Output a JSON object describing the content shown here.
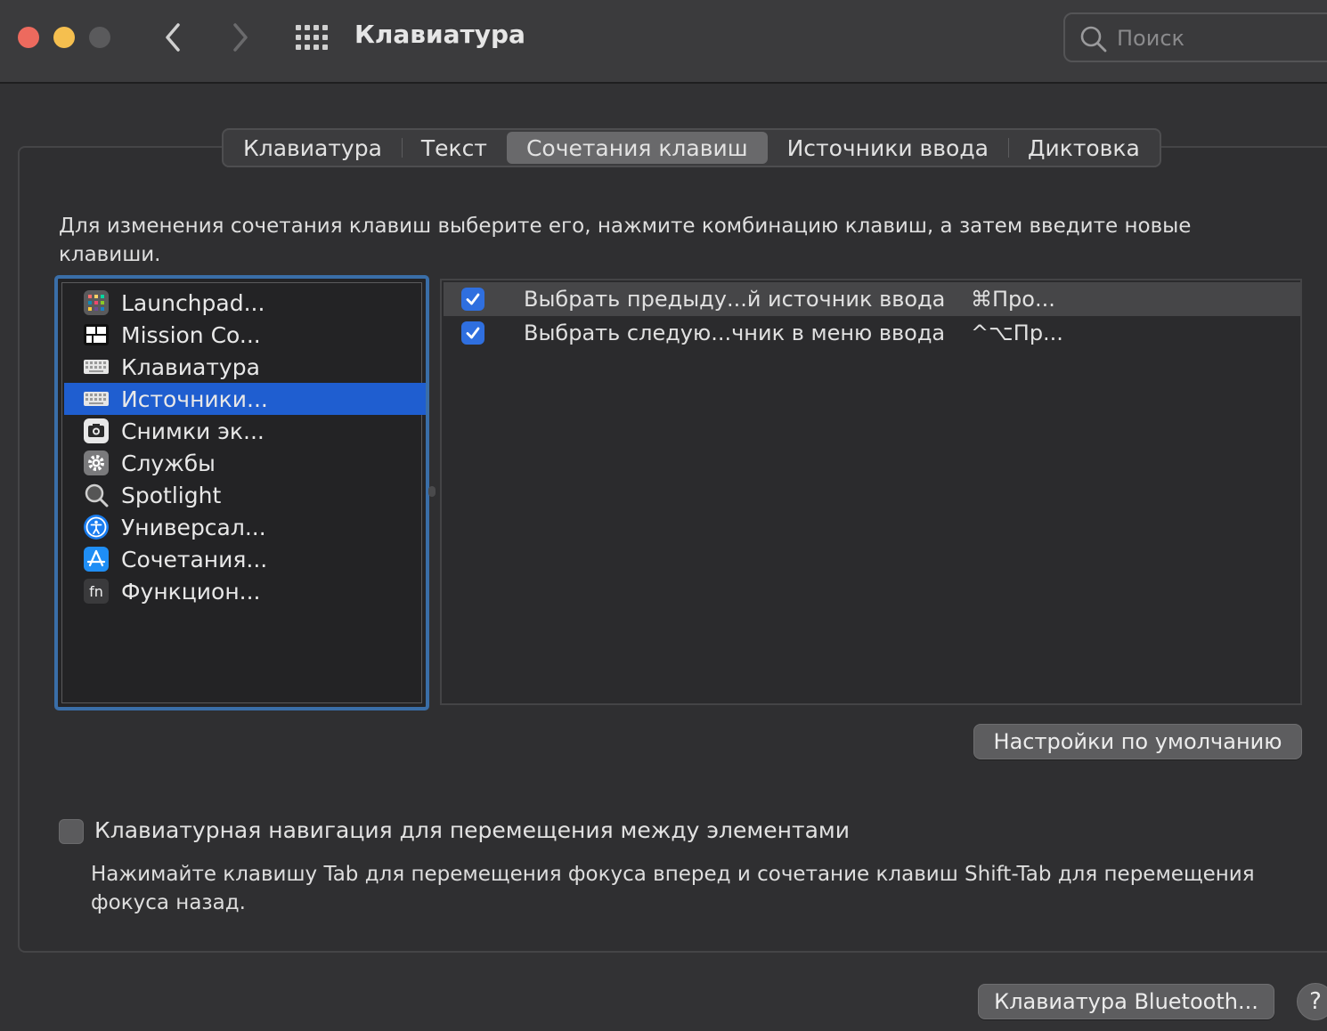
{
  "window": {
    "title": "Клавиатура",
    "search_placeholder": "Поиск"
  },
  "tabs": [
    {
      "label": "Клавиатура",
      "active": false
    },
    {
      "label": "Текст",
      "active": false
    },
    {
      "label": "Сочетания клавиш",
      "active": true
    },
    {
      "label": "Источники ввода",
      "active": false
    },
    {
      "label": "Диктовка",
      "active": false
    }
  ],
  "instructions": "Для изменения сочетания клавиш выберите его, нажмите комбинацию клавиш, а затем введите новые клавиши.",
  "categories": [
    {
      "label": "Launchpad...",
      "icon": "launchpad-icon",
      "selected": false
    },
    {
      "label": "Mission Co...",
      "icon": "mission-control-icon",
      "selected": false
    },
    {
      "label": "Клавиатура",
      "icon": "keyboard-icon",
      "selected": false
    },
    {
      "label": "Источники...",
      "icon": "keyboard-icon",
      "selected": true
    },
    {
      "label": "Снимки эк...",
      "icon": "screenshot-icon",
      "selected": false
    },
    {
      "label": "Службы",
      "icon": "gear-icon",
      "selected": false
    },
    {
      "label": "Spotlight",
      "icon": "magnifier-icon",
      "selected": false
    },
    {
      "label": "Универсал...",
      "icon": "accessibility-icon",
      "selected": false
    },
    {
      "label": "Сочетания...",
      "icon": "app-store-icon",
      "selected": false
    },
    {
      "label": "Функцион...",
      "icon": "fn-icon",
      "selected": false
    }
  ],
  "shortcuts": [
    {
      "label": "Выбрать предыду...й источник ввода",
      "key": "⌘Про...",
      "checked": true
    },
    {
      "label": "Выбрать следую...чник в меню ввода",
      "key": "^⌥Пр...",
      "checked": true
    }
  ],
  "buttons": {
    "defaults": "Настройки по умолчанию",
    "bluetooth": "Клавиатура Bluetooth...",
    "help": "?"
  },
  "keyboard_navigation": {
    "label": "Клавиатурная навигация для перемещения между элементами",
    "description": "Нажимайте клавишу Tab для перемещения фокуса вперед и сочетание клавиш Shift-Tab для перемещения фокуса назад.",
    "checked": false
  },
  "colors": {
    "accent": "#2f6fdf",
    "selection": "#1f5ed0",
    "focus_ring": "#3a6ea8"
  }
}
